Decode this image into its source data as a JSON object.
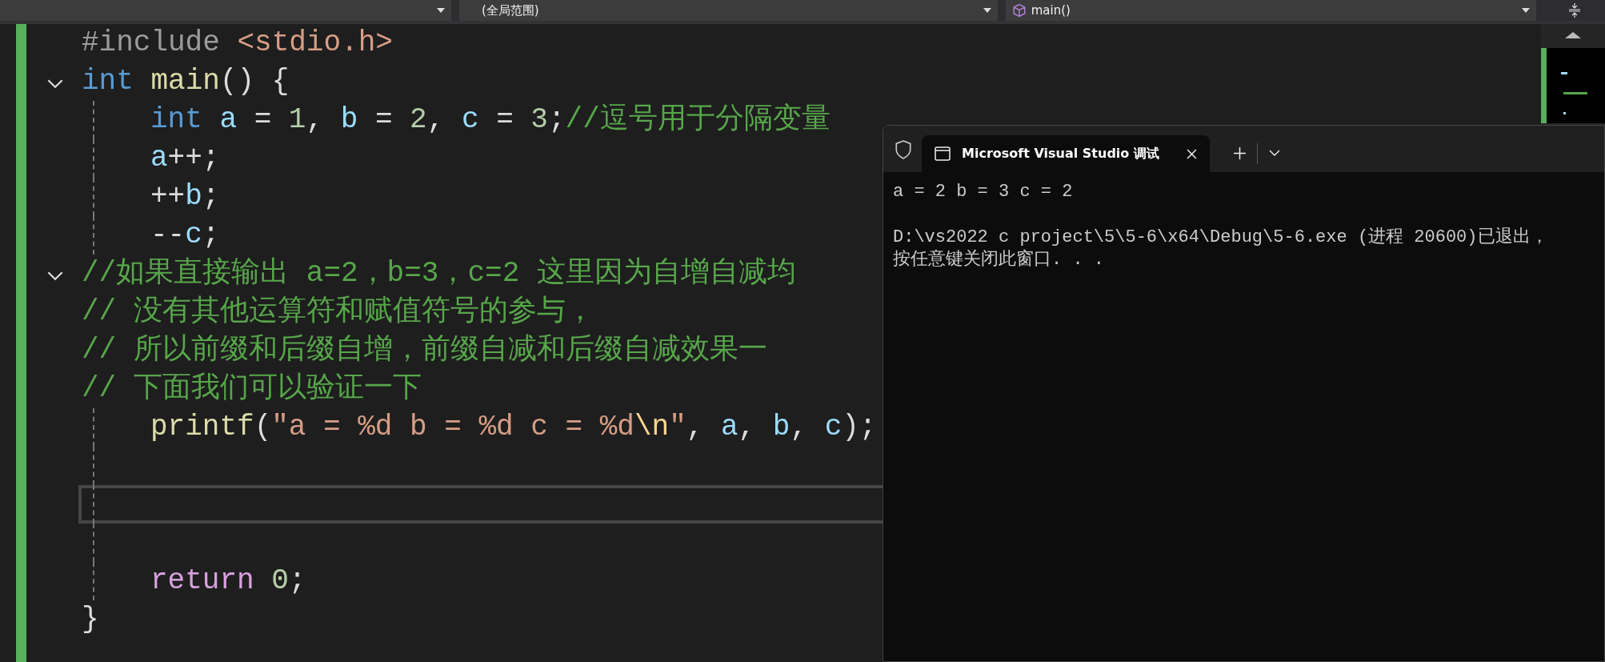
{
  "navbar": {
    "dropdowns": [
      {
        "kind": "plain"
      },
      {
        "kind": "plain",
        "label": "(全局范围)"
      },
      {
        "kind": "member",
        "label": "main()"
      }
    ]
  },
  "editor": {
    "lines": [
      {
        "tokens": [
          {
            "kind": "preproc",
            "text": "#include "
          },
          {
            "kind": "string",
            "text": "<stdio.h>"
          }
        ]
      },
      {
        "fold": true,
        "tokens": [
          {
            "kind": "keyword",
            "text": "int "
          },
          {
            "kind": "func",
            "text": "main"
          },
          {
            "kind": "punct",
            "text": "() {"
          }
        ]
      },
      {
        "indent": true,
        "tokens": [
          {
            "kind": "keyword",
            "text": "int "
          },
          {
            "kind": "var",
            "text": "a"
          },
          {
            "kind": "punct",
            "text": " = "
          },
          {
            "kind": "number",
            "text": "1"
          },
          {
            "kind": "punct",
            "text": ", "
          },
          {
            "kind": "var",
            "text": "b"
          },
          {
            "kind": "punct",
            "text": " = "
          },
          {
            "kind": "number",
            "text": "2"
          },
          {
            "kind": "punct",
            "text": ", "
          },
          {
            "kind": "var",
            "text": "c"
          },
          {
            "kind": "punct",
            "text": " = "
          },
          {
            "kind": "number",
            "text": "3"
          },
          {
            "kind": "punct",
            "text": ";"
          },
          {
            "kind": "comment",
            "text": "//逗号用于分隔变量"
          }
        ]
      },
      {
        "indent": true,
        "tokens": [
          {
            "kind": "var",
            "text": "a"
          },
          {
            "kind": "punct",
            "text": "++;"
          }
        ]
      },
      {
        "indent": true,
        "tokens": [
          {
            "kind": "punct",
            "text": "++"
          },
          {
            "kind": "var",
            "text": "b"
          },
          {
            "kind": "punct",
            "text": ";"
          }
        ]
      },
      {
        "indent": true,
        "tokens": [
          {
            "kind": "punct",
            "text": "--"
          },
          {
            "kind": "var",
            "text": "c"
          },
          {
            "kind": "punct",
            "text": ";"
          }
        ]
      },
      {
        "fold": true,
        "tokens": [
          {
            "kind": "comment",
            "text": "//如果直接输出 a=2，b=3，c=2 这里因为自增自减均"
          }
        ]
      },
      {
        "tokens": [
          {
            "kind": "comment",
            "text": "// 没有其他运算符和赋值符号的参与，"
          }
        ]
      },
      {
        "tokens": [
          {
            "kind": "comment",
            "text": "// 所以前缀和后缀自增，前缀自减和后缀自减效果一"
          }
        ]
      },
      {
        "tokens": [
          {
            "kind": "comment",
            "text": "// 下面我们可以验证一下"
          }
        ]
      },
      {
        "indent": true,
        "tokens": [
          {
            "kind": "func",
            "text": "printf"
          },
          {
            "kind": "punct",
            "text": "("
          },
          {
            "kind": "string",
            "text": "\"a = %d b = %d c = %d"
          },
          {
            "kind": "escape",
            "text": "\\n"
          },
          {
            "kind": "string",
            "text": "\""
          },
          {
            "kind": "punct",
            "text": ", "
          },
          {
            "kind": "var",
            "text": "a"
          },
          {
            "kind": "punct",
            "text": ", "
          },
          {
            "kind": "var",
            "text": "b"
          },
          {
            "kind": "punct",
            "text": ", "
          },
          {
            "kind": "var",
            "text": "c"
          },
          {
            "kind": "punct",
            "text": ");"
          }
        ]
      },
      {
        "indent": true
      },
      {
        "indent": true,
        "current": true
      },
      {
        "indent": true
      },
      {
        "indent": true,
        "tokens": [
          {
            "kind": "control",
            "text": "return "
          },
          {
            "kind": "number",
            "text": "0"
          },
          {
            "kind": "punct",
            "text": ";"
          }
        ]
      },
      {
        "tokens": [
          {
            "kind": "punct",
            "text": "}"
          }
        ]
      }
    ]
  },
  "terminal": {
    "tab_title": "Microsoft Visual Studio 调试",
    "output": [
      "a = 2 b = 3 c = 2",
      "D:\\vs2022 c project\\5\\5-6\\x64\\Debug\\5-6.exe (进程 20600)已退出，",
      "按任意键关闭此窗口. . ."
    ]
  }
}
